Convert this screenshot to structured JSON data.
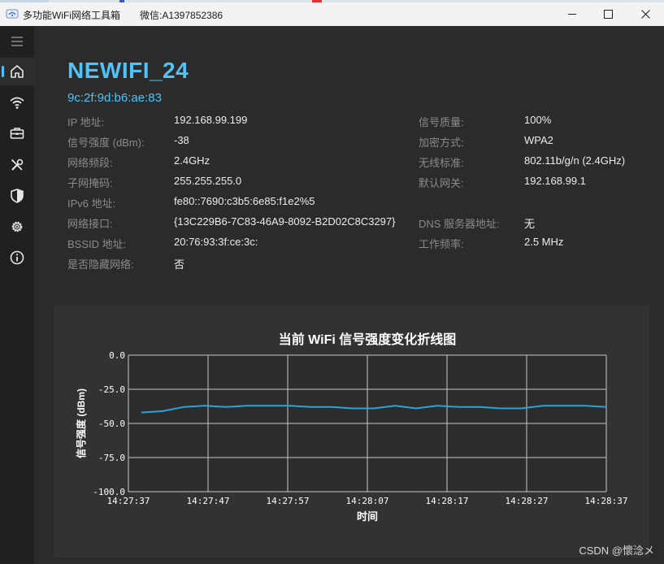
{
  "window": {
    "title": "多功能WiFi网络工具箱",
    "subtitle": "微信:A1397852386"
  },
  "sidebar": {
    "items": [
      {
        "icon": "menu-icon"
      },
      {
        "icon": "home-icon",
        "active": true
      },
      {
        "icon": "wifi-icon"
      },
      {
        "icon": "toolbox-icon"
      },
      {
        "icon": "tools-icon"
      },
      {
        "icon": "shield-icon"
      },
      {
        "icon": "gear-icon"
      },
      {
        "icon": "info-icon"
      }
    ]
  },
  "network": {
    "ssid": "NEWIFI_24",
    "mac": "9c:2f:9d:b6:ae:83",
    "left_fields": [
      {
        "label": "IP 地址:",
        "value": "192.168.99.199"
      },
      {
        "label": "信号强度 (dBm):",
        "value": "-38"
      },
      {
        "label": "网络频段:",
        "value": "2.4GHz"
      },
      {
        "label": "子网掩码:",
        "value": "255.255.255.0"
      },
      {
        "label": "IPv6 地址:",
        "value": "fe80::7690:c3b5:6e85:f1e2%5"
      },
      {
        "label": "网络接口:",
        "value": "{13C229B6-7C83-46A9-8092-B2D02C8C3297}"
      },
      {
        "label": "BSSID 地址:",
        "value": "20:76:93:3f:ce:3c:"
      },
      {
        "label": "是否隐藏网络:",
        "value": "否"
      }
    ],
    "right_fields": [
      {
        "label": "信号质量:",
        "value": "100%"
      },
      {
        "label": "加密方式:",
        "value": "WPA2"
      },
      {
        "label": "无线标准:",
        "value": "802.11b/g/n (2.4GHz)"
      },
      {
        "label": "默认网关:",
        "value": "192.168.99.1"
      },
      {
        "label": "",
        "value": ""
      },
      {
        "label": "DNS 服务器地址:",
        "value": "无"
      },
      {
        "label": "工作频率:",
        "value": "2.5 MHz"
      }
    ]
  },
  "chart_data": {
    "type": "line",
    "title": "当前 WiFi 信号强度变化折线图",
    "xlabel": "时间",
    "ylabel": "信号强度 (dBm)",
    "ylim": [
      -100,
      0
    ],
    "yticks": [
      "0.0",
      "-25.0",
      "-50.0",
      "-75.0",
      "-100.0"
    ],
    "xticks": [
      "14:27:37",
      "14:27:47",
      "14:27:57",
      "14:28:07",
      "14:28:17",
      "14:28:27",
      "14:28:37"
    ],
    "grid": true,
    "line_color": "#29a3dc",
    "series": [
      {
        "values": [
          -42,
          -41,
          -38,
          -37,
          -38,
          -37,
          -37,
          -37,
          -38,
          -38,
          -39,
          -39,
          -37,
          -39,
          -37,
          -38,
          -38,
          -39,
          -39,
          -37,
          -37,
          -37,
          -38
        ]
      }
    ]
  },
  "watermark": "CSDN @懷淰メ"
}
